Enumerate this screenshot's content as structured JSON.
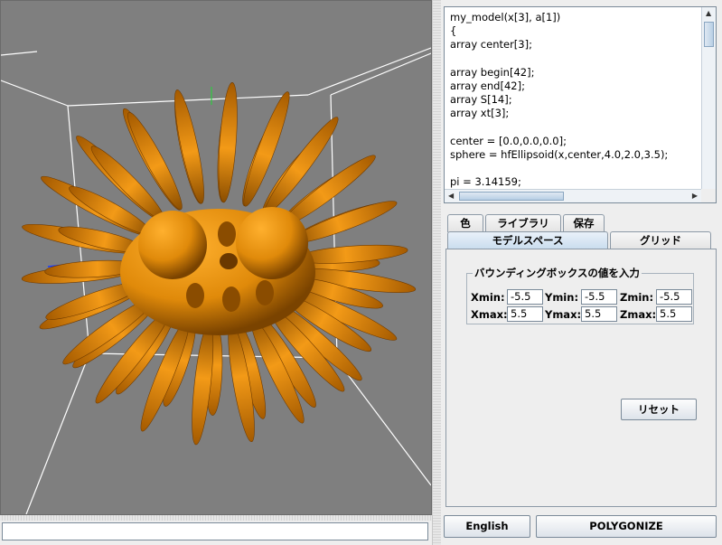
{
  "editor": {
    "code": "my_model(x[3], a[1])\n{\narray center[3];\n\narray begin[42];\narray end[42];\narray S[14];\narray xt[3];\n\ncenter = [0.0,0.0,0.0];\nsphere = hfEllipsoid(x,center,4.0,2.0,3.5);\n\npi = 3.14159;"
  },
  "tabs_row1": [
    "色",
    "ライブラリ",
    "保存"
  ],
  "tabs_row2": [
    "モデルスペース",
    "グリッド"
  ],
  "bbox": {
    "title": "バウンディングボックスの値を入力",
    "xmin_label": "Xmin:",
    "xmin": "-5.5",
    "ymin_label": "Ymin:",
    "ymin": "-5.5",
    "zmin_label": "Zmin:",
    "zmin": "-5.5",
    "xmax_label": "Xmax:",
    "xmax": "5.5",
    "ymax_label": "Ymax:",
    "ymax": "5.5",
    "zmax_label": "Zmax:",
    "zmax": "5.5"
  },
  "reset_label": "リセット",
  "english_label": "English",
  "polygonize_label": "POLYGONIZE",
  "bottom_input_value": "",
  "colors": {
    "model": "#e08a0a",
    "viewport_bg": "#7f7f7f",
    "grid_lines": "#ffffff"
  }
}
